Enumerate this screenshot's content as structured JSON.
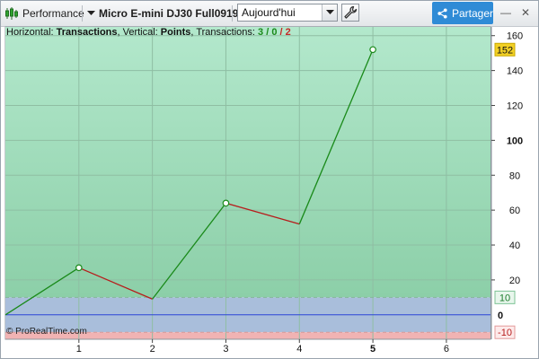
{
  "toolbar": {
    "performance_label": "Performance",
    "instrument_label": "Micro E-mini DJ30 Full0919",
    "period_select_value": "Aujourd'hui",
    "share_label": "Partager",
    "minimize_symbol": "—",
    "close_symbol": "✕"
  },
  "info_bar": {
    "horizontal_prefix": "Horizontal: ",
    "horizontal_value": "Transactions",
    "vertical_prefix": ", Vertical: ",
    "vertical_value": "Points",
    "transactions_prefix": ", Transactions: ",
    "winning": "3",
    "slash1": " / ",
    "neutral": "0",
    "slash2": " / ",
    "losing": "2"
  },
  "copyright": "© ProRealTime.com",
  "icons": {
    "performance": "candlestick-chart-icon",
    "dropdown": "dropdown-arrow-icon",
    "wrench": "wrench-icon",
    "share": "share-icon"
  },
  "colors": {
    "gain_fill": "#a6e0c2",
    "loss_fill": "#f1b3b3",
    "zero_line": "#2b44d8",
    "up_segment": "#1a8a1a",
    "down_segment": "#b71c1c",
    "current_badge": "#f2d024",
    "accent": "#2f8bd6"
  },
  "chart_data": {
    "type": "line",
    "xlabel": "",
    "ylabel": "",
    "x": [
      0,
      1,
      2,
      3,
      4,
      5
    ],
    "y": [
      0,
      27,
      9,
      64,
      52,
      152
    ],
    "markers_at": [
      1,
      3,
      5
    ],
    "xlim": [
      0,
      6.6
    ],
    "ylim": [
      -14,
      165
    ],
    "x_ticks": [
      "1",
      "2",
      "3",
      "4",
      "5",
      "6"
    ],
    "x_tick_values": [
      1,
      2,
      3,
      4,
      5,
      6
    ],
    "bold_x_tick": "5",
    "y_ticks": [
      "20",
      "40",
      "60",
      "80",
      "100",
      "120",
      "140",
      "160"
    ],
    "y_tick_values": [
      20,
      40,
      60,
      80,
      100,
      120,
      140,
      160
    ],
    "bold_y_tick": "100",
    "current_value_label": "152",
    "current_value": 152,
    "upper_band_label": "10",
    "upper_band_value": 10,
    "zero_label": "0",
    "zero_value": 0,
    "lower_band_label": "-10",
    "lower_band_value": -10,
    "grid": true
  }
}
